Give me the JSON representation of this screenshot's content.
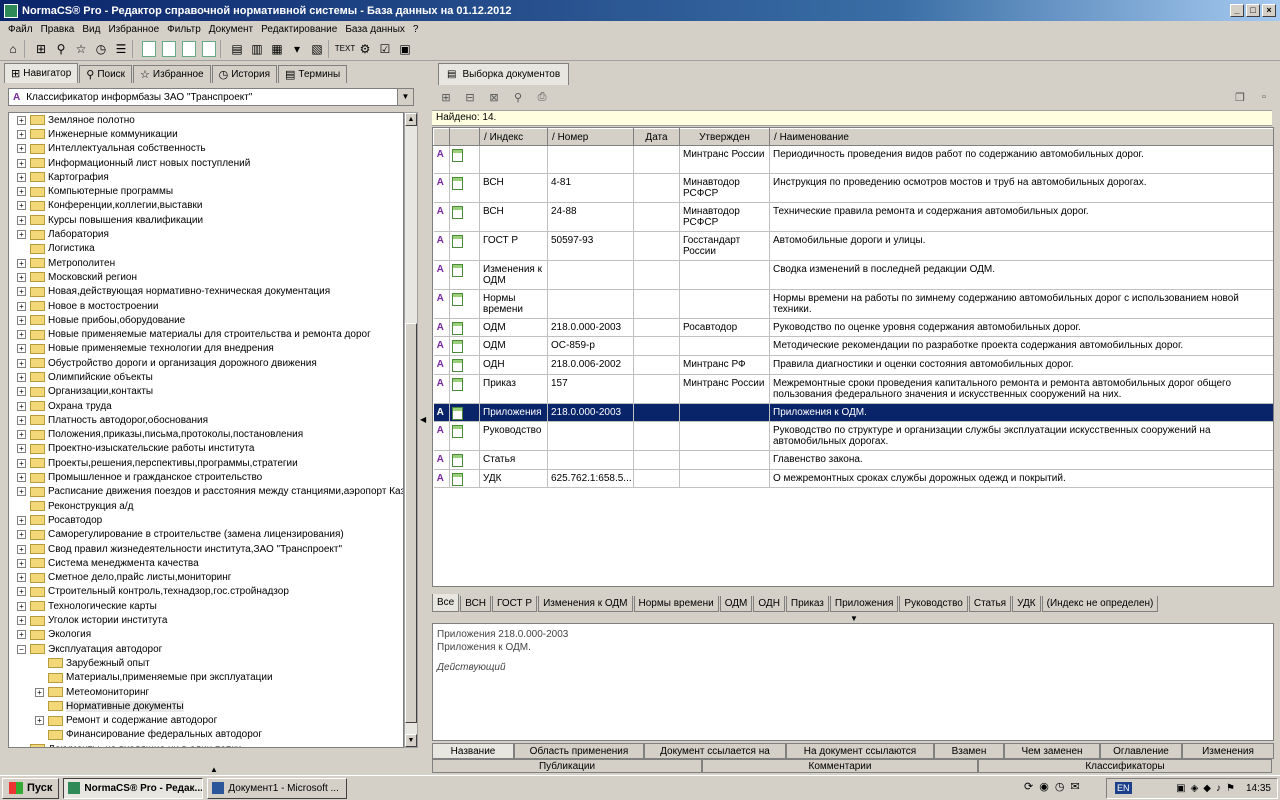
{
  "window": {
    "title": "NormaCS® Pro - Редактор справочной нормативной системы - База данных на 01.12.2012",
    "buttons": [
      "_",
      "□",
      "×"
    ]
  },
  "menu": [
    "Файл",
    "Правка",
    "Вид",
    "Избранное",
    "Фильтр",
    "Документ",
    "Редактирование",
    "База данных",
    "?"
  ],
  "left_tabs": [
    {
      "label": "Навигатор",
      "icon": "navigator-icon"
    },
    {
      "label": "Поиск",
      "icon": "binoculars-icon"
    },
    {
      "label": "Избранное",
      "icon": "star-icon"
    },
    {
      "label": "История",
      "icon": "clock-icon"
    },
    {
      "label": "Термины",
      "icon": "book-icon"
    }
  ],
  "classifier": {
    "prefix": "A",
    "value": "Классификатор информбазы ЗАО \"Транспроект\""
  },
  "tree": [
    {
      "label": "Земляное полотно",
      "expandable": true
    },
    {
      "label": "Инженерные коммуникации",
      "expandable": true
    },
    {
      "label": "Интеллектуальная собственность",
      "expandable": true
    },
    {
      "label": "Информационный лист новых поступлений",
      "expandable": true
    },
    {
      "label": "Картография",
      "expandable": true
    },
    {
      "label": "Компьютерные программы",
      "expandable": true
    },
    {
      "label": "Конференции,коллегии,выставки",
      "expandable": true
    },
    {
      "label": "Курсы повышения квалификации",
      "expandable": true
    },
    {
      "label": "Лаборатория",
      "expandable": true
    },
    {
      "label": "Логистика",
      "expandable": false
    },
    {
      "label": "Метрополитен",
      "expandable": true
    },
    {
      "label": "Московский регион",
      "expandable": true
    },
    {
      "label": "Новая,действующая нормативно-техническая документация",
      "expandable": true
    },
    {
      "label": "Новое в мостостроении",
      "expandable": true
    },
    {
      "label": "Новые прибоы,оборудование",
      "expandable": true
    },
    {
      "label": "Новые применяемые материалы для строительства и ремонта дорог",
      "expandable": true
    },
    {
      "label": "Новые применяемые технологии для внедрения",
      "expandable": true
    },
    {
      "label": "Обустройство дороги и организация дорожного движения",
      "expandable": true
    },
    {
      "label": "Олимпийские объекты",
      "expandable": true
    },
    {
      "label": "Организации,контакты",
      "expandable": true
    },
    {
      "label": "Охрана труда",
      "expandable": true
    },
    {
      "label": "Платность автодорог,обоснования",
      "expandable": true
    },
    {
      "label": "Положения,приказы,письма,протоколы,постановления",
      "expandable": true
    },
    {
      "label": "Проектно-изыскательские работы института",
      "expandable": true
    },
    {
      "label": "Проекты,решения,перспективы,программы,стратегии",
      "expandable": true
    },
    {
      "label": "Промышленное и гражданское строительство",
      "expandable": true
    },
    {
      "label": "Расписание движения поездов и расстояния между станциями,аэропорт Каз",
      "expandable": true
    },
    {
      "label": "Реконструкция а/д",
      "expandable": false
    },
    {
      "label": "Росавтодор",
      "expandable": true
    },
    {
      "label": "Саморегулирование в строительстве (замена лицензирования)",
      "expandable": true
    },
    {
      "label": "Свод правил жизнедеятельности института,ЗАО \"Транспроект\"",
      "expandable": true
    },
    {
      "label": "Система менеджмента качества",
      "expandable": true
    },
    {
      "label": "Сметное дело,прайс листы,мониторинг",
      "expandable": true
    },
    {
      "label": "Строительный контроль,технадзор,гос.стройнадзор",
      "expandable": true
    },
    {
      "label": "Технологические карты",
      "expandable": true
    },
    {
      "label": "Уголок истории института",
      "expandable": true
    },
    {
      "label": "Экология",
      "expandable": true
    },
    {
      "label": "Эксплуатация автодорог",
      "expandable": true,
      "expanded": true
    },
    {
      "label": "Зарубежный опыт",
      "expandable": false,
      "child": true
    },
    {
      "label": "Материалы,применяемые при эксплуатации",
      "expandable": false,
      "child": true
    },
    {
      "label": "Метеомониторинг",
      "expandable": true,
      "child": true
    },
    {
      "label": "Нормативные документы",
      "expandable": false,
      "child": true,
      "selected": true
    },
    {
      "label": "Ремонт и содержание автодорог",
      "expandable": true,
      "child": true
    },
    {
      "label": "Финансирование федеральных автодорог",
      "expandable": false,
      "child": true
    },
    {
      "label": "Документы, не входящие ни в один папки",
      "expandable": false
    }
  ],
  "right_tab": {
    "label": "Выборка документов",
    "icon": "documents-icon"
  },
  "found": "Найдено: 14.",
  "columns": [
    "",
    "",
    "Индекс",
    "Номер",
    "Дата",
    "Утвержден",
    "Наименование"
  ],
  "rows": [
    {
      "index": "",
      "number": "",
      "date": "",
      "approved": "Минтранс России",
      "name": "Периодичность проведения видов работ по содержанию автомобильных дорог."
    },
    {
      "index": "ВСН",
      "number": "4-81",
      "date": "",
      "approved": "Минавтодор РСФСР",
      "name": "Инструкция по проведению осмотров мостов и труб на автомобильных дорогах."
    },
    {
      "index": "ВСН",
      "number": "24-88",
      "date": "",
      "approved": "Минавтодор РСФСР",
      "name": "Технические правила ремонта и содержания автомобильных дорог."
    },
    {
      "index": "ГОСТ Р",
      "number": "50597-93",
      "date": "",
      "approved": "Госстандарт России",
      "name": "Автомобильные дороги и улицы."
    },
    {
      "index": "Изменения к ОДМ",
      "number": "",
      "date": "",
      "approved": "",
      "name": "Сводка изменений в последней редакции ОДМ."
    },
    {
      "index": "Нормы времени",
      "number": "",
      "date": "",
      "approved": "",
      "name": "Нормы времени на работы по зимнему содержанию автомобильных дорог с использованием новой техники."
    },
    {
      "index": "ОДМ",
      "number": "218.0.000-2003",
      "date": "",
      "approved": "Росавтодор",
      "name": "Руководство по оценке уровня содержания автомобильных дорог."
    },
    {
      "index": "ОДМ",
      "number": "ОС-859-р",
      "date": "",
      "approved": "",
      "name": "Методические рекомендации по разработке проекта содержания автомобильных дорог."
    },
    {
      "index": "ОДН",
      "number": "218.0.006-2002",
      "date": "",
      "approved": "Минтранс РФ",
      "name": "Правила диагностики и оценки состояния автомобильных дорог."
    },
    {
      "index": "Приказ",
      "number": "157",
      "date": "",
      "approved": "Минтранс России",
      "name": "Межремонтные сроки проведения капитального ремонта и ремонта автомобильных дорог общего пользования федерального значения и искусственных сооружений на них."
    },
    {
      "index": "Приложения",
      "number": "218.0.000-2003",
      "date": "",
      "approved": "",
      "name": "Приложения к ОДМ.",
      "selected": true
    },
    {
      "index": "Руководство",
      "number": "",
      "date": "",
      "approved": "",
      "name": "Руководство по структуре и организации службы эксплуатации искусственных сооружений на автомобильных дорогах."
    },
    {
      "index": "Статья",
      "number": "",
      "date": "",
      "approved": "",
      "name": "Главенство закона."
    },
    {
      "index": "УДК",
      "number": "625.762.1:658.5...",
      "date": "",
      "approved": "",
      "name": "О межремонтных сроках службы дорожных одежд и покрытий."
    }
  ],
  "filter_tabs": [
    "Все",
    "ВСН",
    "ГОСТ Р",
    "Изменения к ОДМ",
    "Нормы времени",
    "ОДМ",
    "ОДН",
    "Приказ",
    "Приложения",
    "Руководство",
    "Статья",
    "УДК",
    "(Индекс не определен)"
  ],
  "detail": {
    "line1": "Приложения 218.0.000-2003",
    "line2": "Приложения к ОДМ.",
    "status": "Действующий"
  },
  "bottom_tabs_1": [
    "Название",
    "Область применения",
    "Документ ссылается на",
    "На документ ссылаются",
    "Взамен",
    "Чем заменен",
    "Оглавление",
    "Изменения"
  ],
  "bottom_tabs_2": [
    "Публикации",
    "Комментарии",
    "Классификаторы"
  ],
  "taskbar": {
    "start": "Пуск",
    "tasks": [
      {
        "label": "NormaCS® Pro - Редак...",
        "active": true
      },
      {
        "label": "Документ1 - Microsoft ...",
        "active": false
      }
    ],
    "lang": "EN",
    "clock": "14:35"
  }
}
